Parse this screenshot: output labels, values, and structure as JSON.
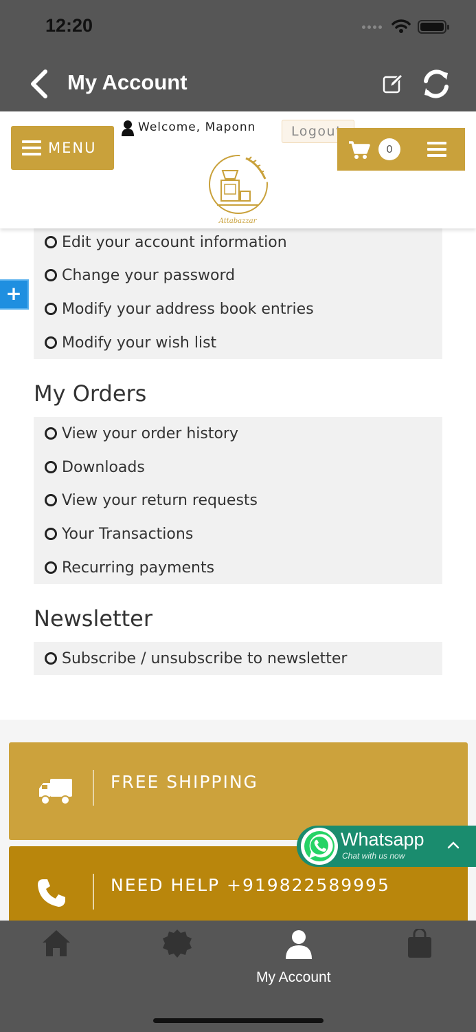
{
  "status": {
    "time": "12:20"
  },
  "nav": {
    "title": "My Account"
  },
  "header": {
    "menu_label": "MENU",
    "welcome": "Welcome, Maponn",
    "logout_label": "Logout",
    "cart_count": "0",
    "logo_text": "Attabazzar"
  },
  "account_section": {
    "items": [
      "Edit your account information",
      "Change your password",
      "Modify your address book entries",
      "Modify your wish list"
    ]
  },
  "orders_section": {
    "title": "My Orders",
    "items": [
      "View your order history",
      "Downloads",
      "View your return requests",
      "Your Transactions",
      "Recurring payments"
    ]
  },
  "newsletter_section": {
    "title": "Newsletter",
    "items": [
      "Subscribe / unsubscribe to newsletter"
    ]
  },
  "footer": {
    "shipping_label": "FREE SHIPPING",
    "help_label": "NEED HELP +919822589995"
  },
  "whatsapp": {
    "title": "Whatsapp",
    "subtitle": "Chat with us now"
  },
  "tab_bar": {
    "tabs": [
      {
        "icon": "home-icon",
        "label": ""
      },
      {
        "icon": "badge-icon",
        "label": ""
      },
      {
        "icon": "account-icon",
        "label": "My Account",
        "active": true
      },
      {
        "icon": "bag-icon",
        "label": ""
      }
    ]
  },
  "colors": {
    "gold": "#c9a13b",
    "dark_gold": "#b9860c",
    "bar": "#565656",
    "whatsapp": "#1a8c6e"
  }
}
